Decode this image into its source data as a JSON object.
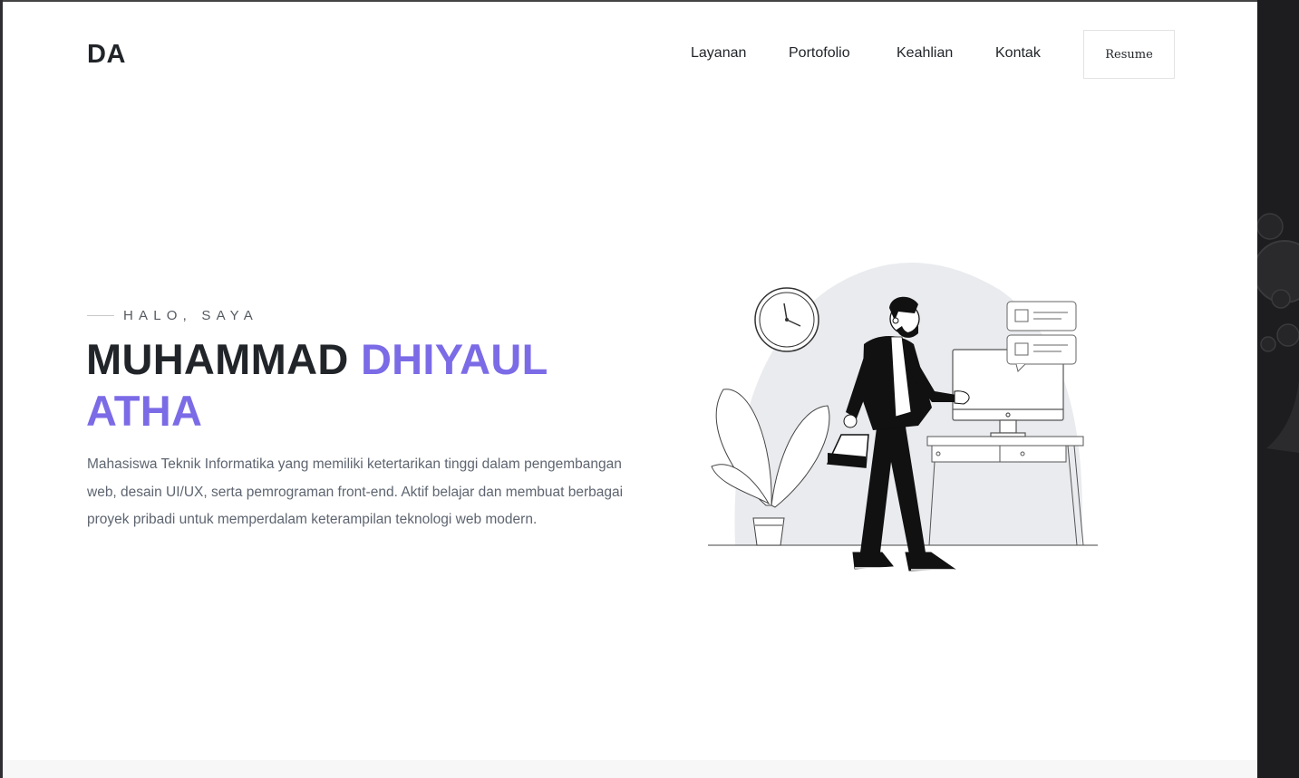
{
  "header": {
    "logo": "DA",
    "nav": [
      {
        "label": "Layanan"
      },
      {
        "label": "Portofolio"
      },
      {
        "label": "Keahlian"
      },
      {
        "label": "Kontak"
      }
    ],
    "resume_label": "Resume"
  },
  "hero": {
    "eyebrow": "HALO, SAYA",
    "name_part1": "MUHAMMAD",
    "name_part2": "DHIYAUL",
    "name_part3": "ATHA",
    "description": "Mahasiswa Teknik Informatika yang memiliki ketertarikan tinggi dalam pengembangan web, desain UI/UX, serta pemrograman front-end. Aktif belajar dan membuat berbagai proyek pribadi untuk memperdalam keterampilan teknologi web modern.",
    "illustration_icon": "businessman-at-desk-illustration"
  },
  "colors": {
    "accent": "#7b6be6",
    "text": "#212529",
    "muted": "#5e6570",
    "background": "#ffffff"
  }
}
